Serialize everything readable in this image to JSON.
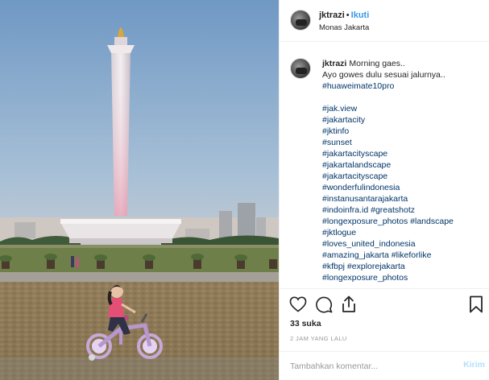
{
  "post": {
    "username": "jktrazi",
    "separator": "•",
    "follow_label": "Ikuti",
    "location": "Monas Jakarta",
    "more_label": "•••"
  },
  "caption": {
    "username": "jktrazi",
    "first_line": "Morning gaes..",
    "second_line": "Ayo gowes dulu sesuai jalurnya..",
    "third_line": "#huaweimate10pro",
    "hashtag_lines": [
      "#jak.view",
      "#jakartacity",
      "#jktinfo",
      "#sunset",
      "#jakartacityscape",
      "#jakartalandscape",
      "#jakartacityscape",
      "#wonderfulindonesia",
      "#instanusantarajakarta",
      "#indoinfra.id #greatshotz",
      "#longexposure_photos #landscape",
      "#jktlogue",
      "#loves_united_indonesia",
      "#amazing_jakarta #likeforlike",
      "#kfbpj #explorejakarta",
      "#longexposure_photos"
    ]
  },
  "actions": {
    "like_icon": "heart-icon",
    "comment_icon": "speech-bubble-icon",
    "share_icon": "share-icon",
    "save_icon": "bookmark-icon"
  },
  "likes_text": "33 suka",
  "timestamp": "2 JAM YANG LALU",
  "comment_form": {
    "placeholder": "Tambahkan komentar...",
    "value": "",
    "submit_label": "Kirim"
  },
  "colors": {
    "accent": "#3897f0",
    "hashtag": "#003569",
    "muted": "#999999",
    "submit_disabled": "#b2dffc"
  }
}
